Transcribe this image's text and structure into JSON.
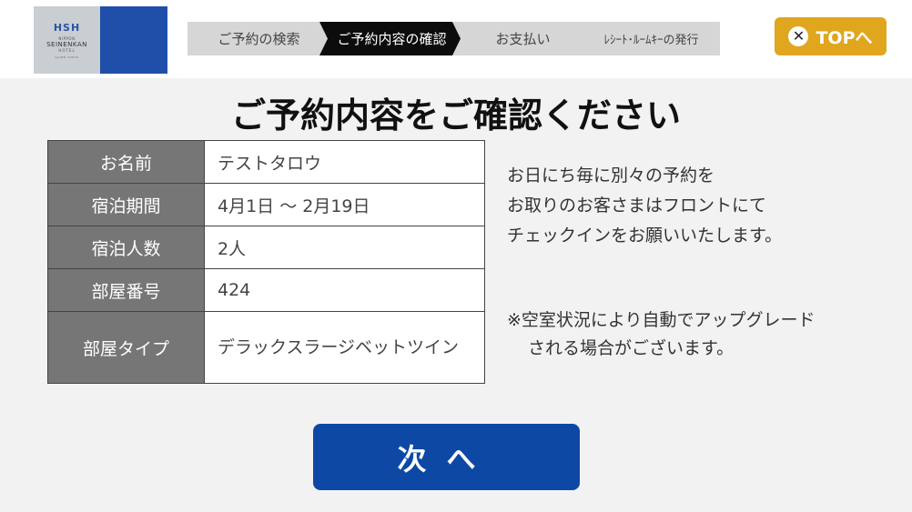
{
  "logo": {
    "mark": "HSH",
    "small": "NIPPON",
    "name": "SEINENKAN",
    "hotel": "HOTEL",
    "location": "GAIEN TOKYO"
  },
  "steps": [
    {
      "label": "ご予約の検索",
      "active": false
    },
    {
      "label": "ご予約内容の確認",
      "active": true
    },
    {
      "label": "お支払い",
      "active": false
    },
    {
      "label": "ﾚｼｰﾄ･ﾙｰﾑｷｰの発行",
      "active": false
    }
  ],
  "top_button": {
    "label": "TOPへ",
    "icon": "close-icon"
  },
  "title": "ご予約内容をご確認ください",
  "reservation": {
    "rows": [
      {
        "label": "お名前",
        "value": "テストタロウ"
      },
      {
        "label": "宿泊期間",
        "value": "4月1日 ～ 2月19日"
      },
      {
        "label": "宿泊人数",
        "value": "2人"
      },
      {
        "label": "部屋番号",
        "value": "424"
      },
      {
        "label": "部屋タイプ",
        "value": "デラックスラージベットツイン"
      }
    ]
  },
  "notes": {
    "line1": "お日にち毎に別々の予約を",
    "line2": "お取りのお客さまはフロントにて",
    "line3": "チェックインをお願いいたします。",
    "upgrade1": "※空室状況により自動でアップグレード",
    "upgrade2": "される場合がございます。"
  },
  "next_button": {
    "label": "次へ"
  },
  "colors": {
    "accent_blue": "#0d49a4",
    "top_button": "#e0a61e",
    "step_active": "#0c0c0c",
    "step_inactive": "#d6d6d6",
    "label_bg": "#767676"
  }
}
